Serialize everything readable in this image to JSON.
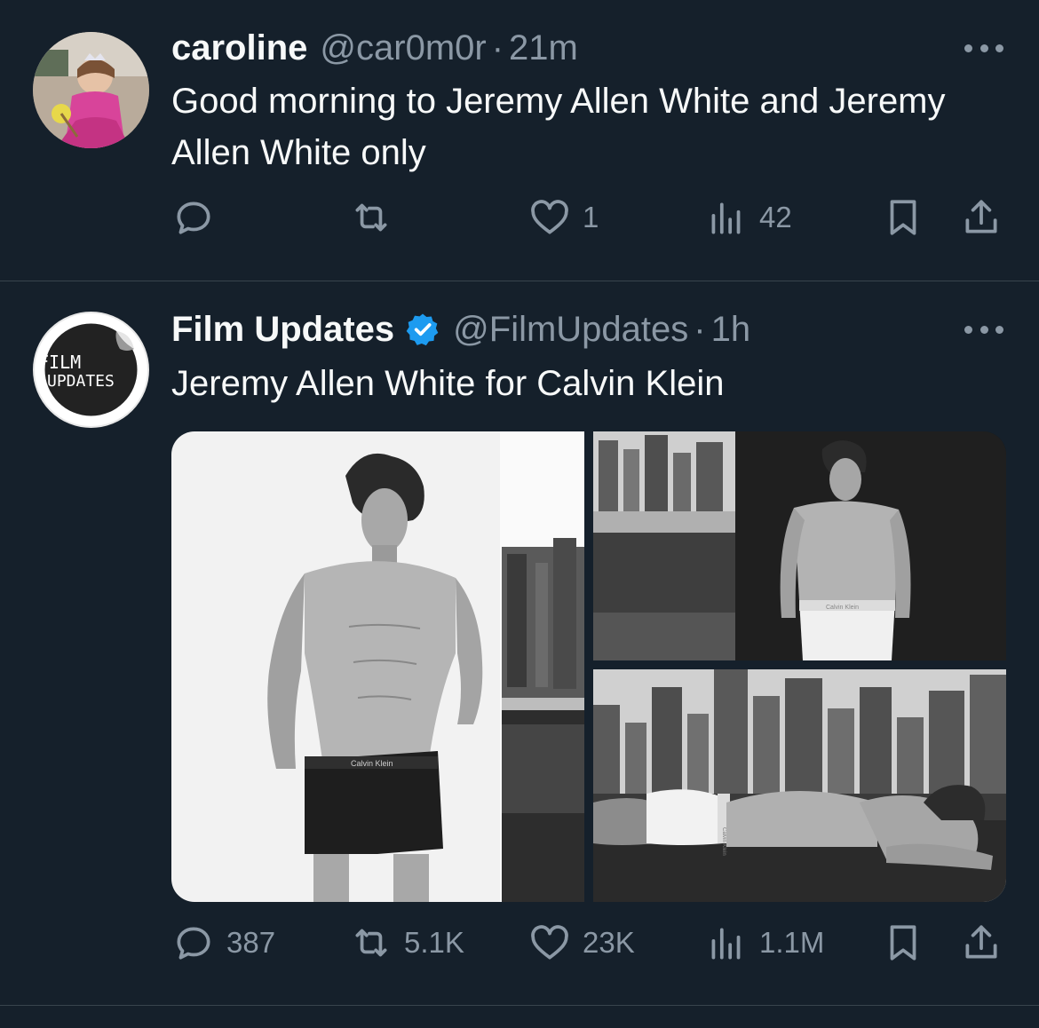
{
  "tweets": [
    {
      "name": "caroline",
      "handle": "@car0m0r",
      "separator": "·",
      "time": "21m",
      "text": "Good morning to Jeremy Allen White and Jeremy Allen White only",
      "stats": {
        "replies": "",
        "reposts": "",
        "likes": "1",
        "views": "42"
      }
    },
    {
      "name": "Film Updates",
      "verified": true,
      "handle": "@FilmUpdates",
      "separator": "·",
      "time": "1h",
      "text": "Jeremy Allen White for Calvin Klein",
      "avatar_logo": {
        "line1": "FILM",
        "line2": "UPDATES"
      },
      "media": {
        "photos": [
          {
            "label": "Calvin Klein",
            "alt_desc": "portrait standing"
          },
          {
            "label": "Calvin Klein",
            "alt_desc": "standing rooftop"
          },
          {
            "label": "Calvin Klein",
            "alt_desc": "lying rooftop"
          }
        ]
      },
      "stats": {
        "replies": "387",
        "reposts": "5.1K",
        "likes": "23K",
        "views": "1.1M"
      }
    }
  ],
  "icons": [
    "reply-icon",
    "repost-icon",
    "like-icon",
    "views-icon",
    "bookmark-icon",
    "share-icon",
    "more-icon",
    "verified-badge-icon"
  ],
  "colors": {
    "background": "#15202b",
    "text": "#f7f9f9",
    "secondary": "#8b98a5",
    "verified": "#1d9bf0",
    "divider": "#38444d"
  }
}
